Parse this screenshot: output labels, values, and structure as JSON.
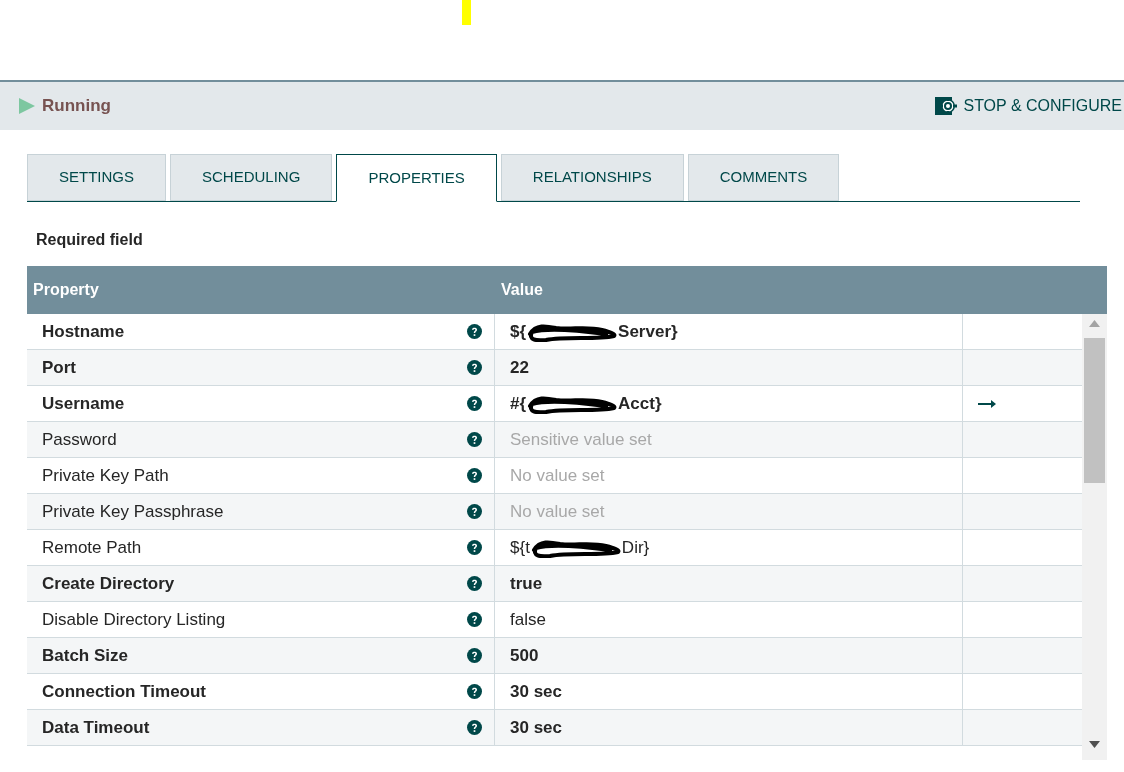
{
  "status": {
    "label": "Running",
    "running": true
  },
  "action_button": "STOP & CONFIGURE",
  "tabs": [
    {
      "label": "SETTINGS",
      "selected": false
    },
    {
      "label": "SCHEDULING",
      "selected": false
    },
    {
      "label": "PROPERTIES",
      "selected": true
    },
    {
      "label": "RELATIONSHIPS",
      "selected": false
    },
    {
      "label": "COMMENTS",
      "selected": false
    }
  ],
  "required_note": "Required field",
  "table": {
    "columns": [
      "Property",
      "Value"
    ],
    "rows": [
      {
        "property": "Hostname",
        "required": true,
        "value": "${",
        "value_end": "Server}",
        "redacted": true,
        "kind": "set"
      },
      {
        "property": "Port",
        "required": true,
        "value": "22",
        "kind": "set"
      },
      {
        "property": "Username",
        "required": true,
        "value": "#{",
        "value_end": "Acct}",
        "redacted": true,
        "kind": "set",
        "parameter_link": true
      },
      {
        "property": "Password",
        "required": false,
        "value": "Sensitive value set",
        "kind": "unset"
      },
      {
        "property": "Private Key Path",
        "required": false,
        "value": "No value set",
        "kind": "unset"
      },
      {
        "property": "Private Key Passphrase",
        "required": false,
        "value": "No value set",
        "kind": "unset"
      },
      {
        "property": "Remote Path",
        "required": false,
        "value": "${t",
        "value_end": "Dir}",
        "redacted": true,
        "kind": "set"
      },
      {
        "property": "Create Directory",
        "required": true,
        "value": "true",
        "kind": "set"
      },
      {
        "property": "Disable Directory Listing",
        "required": false,
        "value": "false",
        "kind": "set"
      },
      {
        "property": "Batch Size",
        "required": true,
        "value": "500",
        "kind": "set"
      },
      {
        "property": "Connection Timeout",
        "required": true,
        "value": "30 sec",
        "kind": "set"
      },
      {
        "property": "Data Timeout",
        "required": true,
        "value": "30 sec",
        "kind": "set"
      }
    ]
  }
}
